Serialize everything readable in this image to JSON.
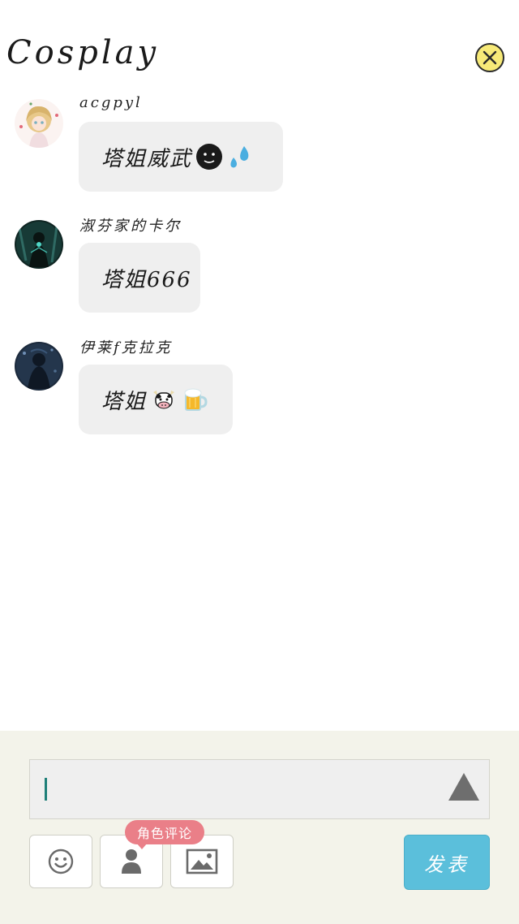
{
  "header": {
    "title": "Cosplay",
    "close_icon": "close-x-icon",
    "close_color": "#f7ea78"
  },
  "comments": [
    {
      "username": "acgpyl",
      "text": "塔姐威武",
      "emojis": [
        "dark-face-emoji",
        "sweat-drops-emoji"
      ]
    },
    {
      "username": "淑芬家的卡尔",
      "text": "塔姐666",
      "emojis": []
    },
    {
      "username": "伊莱f克拉克",
      "text": "塔姐",
      "emojis": [
        "cow-emoji",
        "beer-mug-emoji"
      ]
    }
  ],
  "composer": {
    "input_value": "",
    "expand_icon": "triangle-up-icon",
    "emoji_button_icon": "smiley-icon",
    "role_button_icon": "person-icon",
    "image_button_icon": "image-icon",
    "role_tag": "角色评论",
    "submit_label": "发表"
  },
  "colors": {
    "bubble": "#efefef",
    "bottom_bar": "#f3f3ea",
    "submit": "#5bbfdb",
    "role_tag": "#ea7f88",
    "caret": "#1e7f78"
  }
}
